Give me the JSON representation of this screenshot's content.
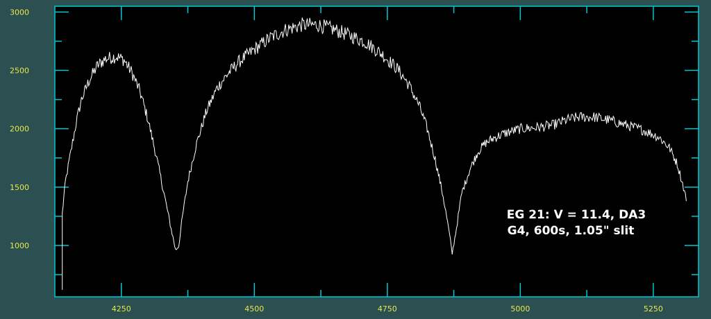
{
  "chart_data": {
    "type": "line",
    "xlim": [
      4125,
      5335
    ],
    "ylim": [
      560,
      3050
    ],
    "x_ticks": [
      4250,
      4500,
      4750,
      5000,
      5250
    ],
    "y_ticks": [
      1000,
      1500,
      2000,
      2500,
      3000
    ],
    "x_minor_ticks": [
      4375,
      4625,
      4875,
      5125
    ],
    "y_minor_ticks": [
      750,
      1250,
      1750,
      2250,
      2750
    ],
    "grid": false,
    "colors": {
      "background": "#2c4f52",
      "plot_area": "#000000",
      "frame": "#00c8d2",
      "tick_labels": "#e8e84a",
      "line": "#ffffff"
    },
    "annotation": {
      "line1": "EG 21: V = 11.4, DA3",
      "line2": "G4, 600s, 1.05\" slit"
    },
    "series": [
      {
        "points": [
          [
            4139,
            620
          ],
          [
            4139,
            1280
          ],
          [
            4145,
            1550
          ],
          [
            4155,
            1800
          ],
          [
            4165,
            2050
          ],
          [
            4175,
            2250
          ],
          [
            4190,
            2420
          ],
          [
            4205,
            2540
          ],
          [
            4220,
            2600
          ],
          [
            4240,
            2620
          ],
          [
            4255,
            2590
          ],
          [
            4270,
            2480
          ],
          [
            4285,
            2320
          ],
          [
            4300,
            2080
          ],
          [
            4315,
            1780
          ],
          [
            4330,
            1450
          ],
          [
            4342,
            1180
          ],
          [
            4352,
            960
          ],
          [
            4358,
            1000
          ],
          [
            4365,
            1250
          ],
          [
            4375,
            1550
          ],
          [
            4390,
            1850
          ],
          [
            4410,
            2150
          ],
          [
            4430,
            2350
          ],
          [
            4450,
            2470
          ],
          [
            4470,
            2570
          ],
          [
            4500,
            2680
          ],
          [
            4530,
            2780
          ],
          [
            4560,
            2850
          ],
          [
            4590,
            2890
          ],
          [
            4620,
            2890
          ],
          [
            4650,
            2850
          ],
          [
            4680,
            2800
          ],
          [
            4710,
            2740
          ],
          [
            4740,
            2640
          ],
          [
            4770,
            2510
          ],
          [
            4790,
            2380
          ],
          [
            4810,
            2200
          ],
          [
            4825,
            2000
          ],
          [
            4840,
            1740
          ],
          [
            4855,
            1420
          ],
          [
            4865,
            1150
          ],
          [
            4872,
            930
          ],
          [
            4880,
            1150
          ],
          [
            4890,
            1450
          ],
          [
            4905,
            1650
          ],
          [
            4920,
            1800
          ],
          [
            4935,
            1880
          ],
          [
            4950,
            1920
          ],
          [
            4970,
            1960
          ],
          [
            5000,
            2000
          ],
          [
            5030,
            2010
          ],
          [
            5060,
            2030
          ],
          [
            5090,
            2080
          ],
          [
            5110,
            2100
          ],
          [
            5140,
            2100
          ],
          [
            5170,
            2070
          ],
          [
            5200,
            2030
          ],
          [
            5230,
            1990
          ],
          [
            5260,
            1930
          ],
          [
            5280,
            1840
          ],
          [
            5295,
            1700
          ],
          [
            5305,
            1530
          ],
          [
            5312,
            1400
          ]
        ]
      }
    ]
  }
}
